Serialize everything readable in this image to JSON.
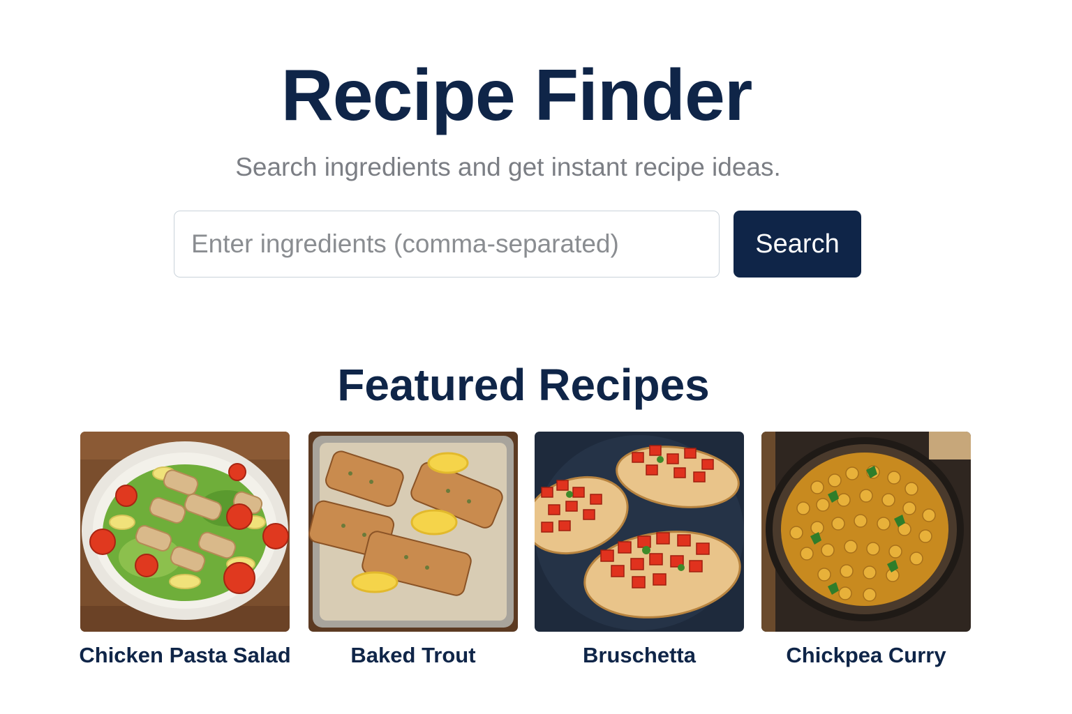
{
  "header": {
    "title": "Recipe Finder",
    "subtitle": "Search ingredients and get instant recipe ideas."
  },
  "search": {
    "placeholder": "Enter ingredients (comma-separated)",
    "value": "",
    "button_label": "Search"
  },
  "featured": {
    "heading": "Featured Recipes",
    "recipes": [
      {
        "name": "Chicken Pasta Salad",
        "image": "chicken-pasta-salad-photo"
      },
      {
        "name": "Baked Trout",
        "image": "baked-trout-photo"
      },
      {
        "name": "Bruschetta",
        "image": "bruschetta-photo"
      },
      {
        "name": "Chickpea Curry",
        "image": "chickpea-curry-photo"
      }
    ]
  },
  "colors": {
    "primary": "#0f2548",
    "muted_text": "#7b7e84",
    "input_border": "#c9d2da",
    "background": "#ffffff"
  }
}
